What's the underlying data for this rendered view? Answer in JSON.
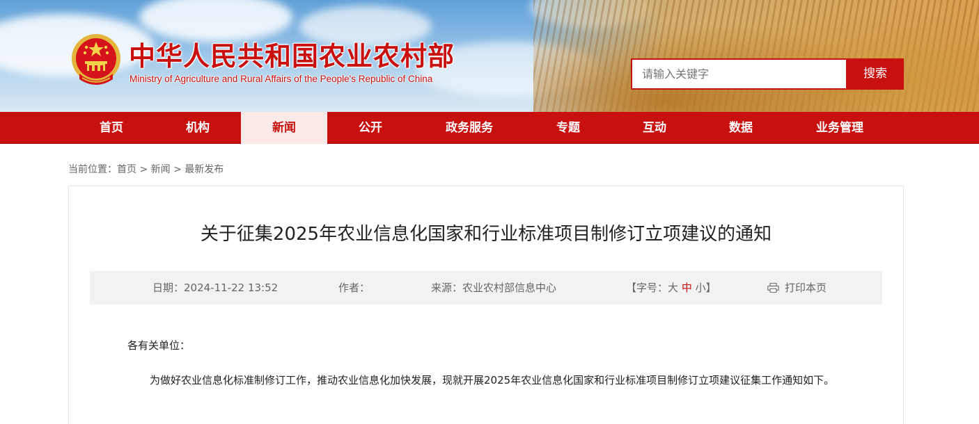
{
  "header": {
    "title": "中华人民共和国农业农村部",
    "subtitle": "Ministry of Agriculture and Rural Affairs of the People's Republic of China",
    "emblem_icon": "national-emblem-icon",
    "search": {
      "placeholder": "请输入关键字",
      "button_label": "搜索"
    }
  },
  "colors": {
    "brand_red": "#c8100f",
    "nav_active_bg": "#fbeae8",
    "meta_bg": "#f2f2f2"
  },
  "nav": {
    "items": [
      "首页",
      "机构",
      "新闻",
      "公开",
      "政务服务",
      "专题",
      "互动",
      "数据",
      "业务管理"
    ],
    "active": "新闻"
  },
  "breadcrumb": {
    "prefix": "当前位置：",
    "items": [
      "首页",
      "新闻",
      "最新发布"
    ],
    "separator": ">"
  },
  "article": {
    "title": "关于征集2025年农业信息化国家和行业标准项目制修订立项建议的通知",
    "meta": {
      "date": "日期：2024-11-22 13:52",
      "author": "作者：",
      "source": "来源：农业农村部信息中心",
      "font_size_open": "【字号：",
      "font_large": "大",
      "font_medium": "中",
      "font_small": "小",
      "font_size_close": "】",
      "print_label": "打印本页",
      "print_icon": "printer-icon"
    },
    "salutation": "各有关单位：",
    "paragraph": "为做好农业信息化标准制修订工作，推动农业信息化加快发展，现就开展2025年农业信息化国家和行业标准项目制修订立项建议征集工作通知如下。"
  }
}
